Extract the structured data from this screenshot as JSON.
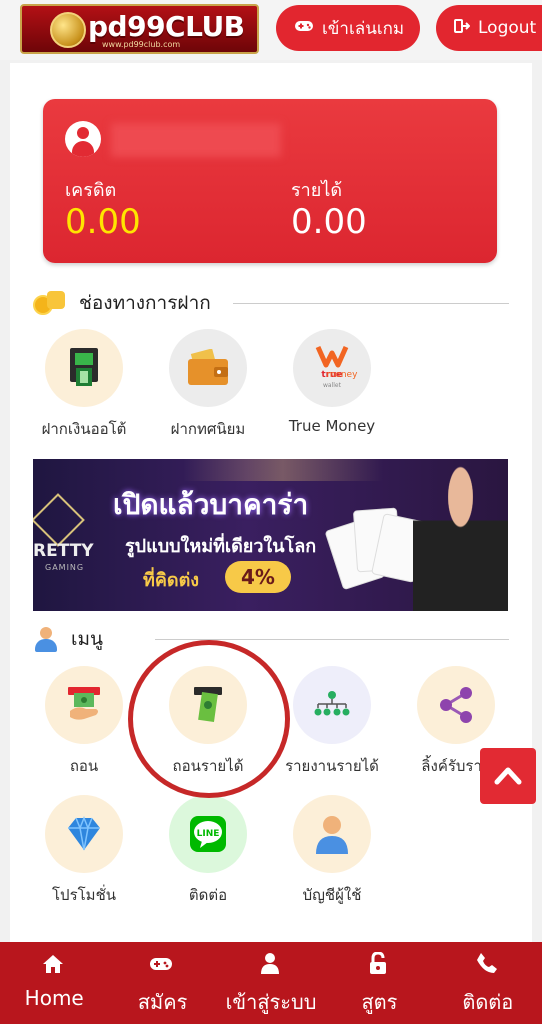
{
  "header": {
    "logo_text": "pd99CLUB",
    "logo_sub": "www.pd99club.com",
    "play_button": "เข้าเล่นเกม",
    "logout_button": "Logout"
  },
  "balance_card": {
    "credit_label": "เครดิต",
    "credit_value": "0.00",
    "income_label": "รายได้",
    "income_value": "0.00"
  },
  "deposit_section": {
    "title": "ช่องทางการฝาก",
    "items": [
      {
        "label": "ฝากเงินออโต้",
        "icon": "atm-icon"
      },
      {
        "label": "ฝากทศนิยม",
        "icon": "wallet-icon"
      },
      {
        "label": "True Money",
        "icon": "truemoney-icon"
      }
    ]
  },
  "banner": {
    "brand": "RETTY",
    "brand_sub": "GAMING",
    "headline": "เปิดแล้วบาคาร่า",
    "subline": "รูปแบบใหม่ที่เดียวในโลก",
    "promo_text": "ที่คิดต่ง",
    "promo_pct": "4%"
  },
  "menu_section": {
    "title": "เมนู",
    "items": [
      {
        "label": "ถอน",
        "icon": "cash-withdraw-icon"
      },
      {
        "label": "ถอนรายได้",
        "icon": "income-withdraw-icon"
      },
      {
        "label": "รายงานรายได้",
        "icon": "network-icon"
      },
      {
        "label": "ลิ้งค์รับราย",
        "icon": "share-icon"
      },
      {
        "label": "โปรโมชั่น",
        "icon": "diamond-icon"
      },
      {
        "label": "ติดต่อ",
        "icon": "line-icon"
      },
      {
        "label": "บัญชีผู้ใช้",
        "icon": "user-account-icon"
      }
    ]
  },
  "bottom_nav": {
    "items": [
      {
        "label": "Home",
        "icon": "home-icon"
      },
      {
        "label": "สมัคร",
        "icon": "gamepad-icon"
      },
      {
        "label": "เข้าสู่ระบบ",
        "icon": "user-icon"
      },
      {
        "label": "สูตร",
        "icon": "lock-icon"
      },
      {
        "label": "ติดต่อ",
        "icon": "phone-icon"
      }
    ]
  },
  "colors": {
    "brand_red": "#e2262f",
    "nav_red": "#b8161d",
    "credit_yellow": "#ffe500"
  }
}
